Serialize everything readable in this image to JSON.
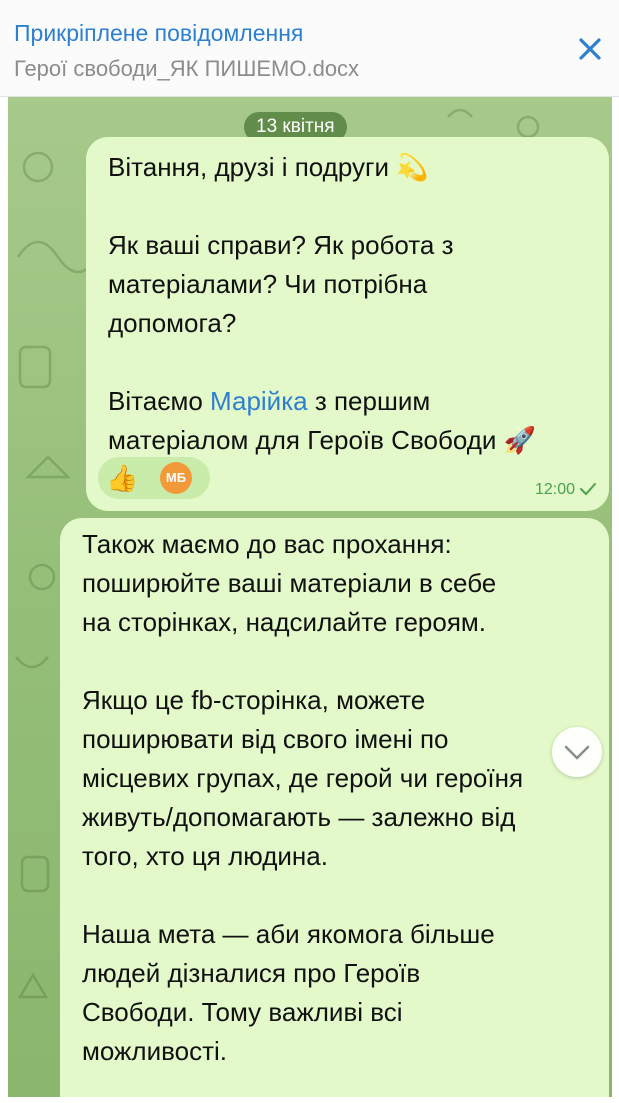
{
  "pinned": {
    "title": "Прикріплене повідомлення",
    "subtitle": "Герої свободи_ЯК ПИШЕМО.docx"
  },
  "chat": {
    "date": "13 квітня",
    "message1": {
      "line1": "Вітання, друзі і подруги 💫",
      "para2": "Як ваші справи? Як робота з\nматеріалами? Чи потрібна\nдопомога?",
      "para3_prefix": "Вітаємо ",
      "para3_link": "Марійка",
      "para3_suffix": " з першим",
      "para3_line2": "матеріалом для Героїв Свободи 🚀",
      "reaction_emoji": "👍",
      "reaction_avatar_initials": "МБ",
      "time": "12:00"
    },
    "message2": {
      "para1": "Також маємо до вас прохання:\nпоширюйте ваші матеріали в себе\nна сторінках, надсилайте героям.",
      "para2": "Якщо це fb-сторінка, можете\nпоширювати від свого імені по\nмісцевих групах, де герой чи героїня\nживуть/допомагають — залежно від\nтого, хто ця людина.",
      "para3": "Наша мета — аби якомога більше\nлюдей дізналися про Героїв\nСвободи. Тому важливі всі\nможливості.",
      "trailing_emoji": "❤"
    }
  },
  "colors": {
    "accent": "#2d7fd0",
    "bubble": "#e3f9c9",
    "time": "#4aa24c"
  }
}
